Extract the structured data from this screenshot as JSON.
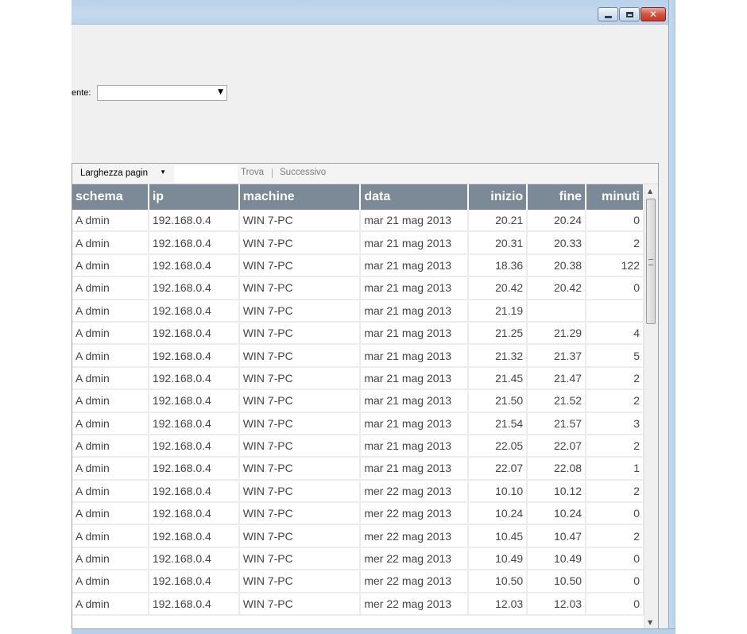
{
  "window": {
    "controls": {
      "minimize_icon": "minimize-icon",
      "maximize_icon": "maximize-icon",
      "close_glyph": "✕"
    }
  },
  "filter": {
    "label": "ente:",
    "value": ""
  },
  "toolbar": {
    "zoom_value": "Larghezza pagin",
    "find_text": "",
    "find_label": "Trova",
    "next_label": "Successivo"
  },
  "table": {
    "columns": [
      {
        "key": "schema",
        "label": "schema",
        "align": "left"
      },
      {
        "key": "ip",
        "label": "ip",
        "align": "left"
      },
      {
        "key": "machine",
        "label": "machine",
        "align": "left"
      },
      {
        "key": "data",
        "label": "data",
        "align": "left"
      },
      {
        "key": "inizio",
        "label": "inizio",
        "align": "right"
      },
      {
        "key": "fine",
        "label": "fine",
        "align": "right"
      },
      {
        "key": "minuti",
        "label": "minuti",
        "align": "right"
      }
    ],
    "rows": [
      [
        "A dmin",
        "192.168.0.4",
        "WIN 7-PC",
        "mar 21 mag 2013",
        "20.21",
        "20.24",
        "0"
      ],
      [
        "A dmin",
        "192.168.0.4",
        "WIN 7-PC",
        "mar 21 mag 2013",
        "20.31",
        "20.33",
        "2"
      ],
      [
        "A dmin",
        "192.168.0.4",
        "WIN 7-PC",
        "mar 21 mag 2013",
        "18.36",
        "20.38",
        "122"
      ],
      [
        "A dmin",
        "192.168.0.4",
        "WIN 7-PC",
        "mar 21 mag 2013",
        "20.42",
        "20.42",
        "0"
      ],
      [
        "A dmin",
        "192.168.0.4",
        "WIN 7-PC",
        "mar 21 mag 2013",
        "21.19",
        "",
        ""
      ],
      [
        "A dmin",
        "192.168.0.4",
        "WIN 7-PC",
        "mar 21 mag 2013",
        "21.25",
        "21.29",
        "4"
      ],
      [
        "A dmin",
        "192.168.0.4",
        "WIN 7-PC",
        "mar 21 mag 2013",
        "21.32",
        "21.37",
        "5"
      ],
      [
        "A dmin",
        "192.168.0.4",
        "WIN 7-PC",
        "mar 21 mag 2013",
        "21.45",
        "21.47",
        "2"
      ],
      [
        "A dmin",
        "192.168.0.4",
        "WIN 7-PC",
        "mar 21 mag 2013",
        "21.50",
        "21.52",
        "2"
      ],
      [
        "A dmin",
        "192.168.0.4",
        "WIN 7-PC",
        "mar 21 mag 2013",
        "21.54",
        "21.57",
        "3"
      ],
      [
        "A dmin",
        "192.168.0.4",
        "WIN 7-PC",
        "mar 21 mag 2013",
        "22.05",
        "22.07",
        "2"
      ],
      [
        "A dmin",
        "192.168.0.4",
        "WIN 7-PC",
        "mar 21 mag 2013",
        "22.07",
        "22.08",
        "1"
      ],
      [
        "A dmin",
        "192.168.0.4",
        "WIN 7-PC",
        "mer 22 mag 2013",
        "10.10",
        "10.12",
        "2"
      ],
      [
        "A dmin",
        "192.168.0.4",
        "WIN 7-PC",
        "mer 22 mag 2013",
        "10.24",
        "10.24",
        "0"
      ],
      [
        "A dmin",
        "192.168.0.4",
        "WIN 7-PC",
        "mer 22 mag 2013",
        "10.45",
        "10.47",
        "2"
      ],
      [
        "A dmin",
        "192.168.0.4",
        "WIN 7-PC",
        "mer 22 mag 2013",
        "10.49",
        "10.49",
        "0"
      ],
      [
        "A dmin",
        "192.168.0.4",
        "WIN 7-PC",
        "mer 22 mag 2013",
        "10.50",
        "10.50",
        "0"
      ],
      [
        "A dmin",
        "192.168.0.4",
        "WIN 7-PC",
        "mer 22 mag 2013",
        "12.03",
        "12.03",
        "0"
      ]
    ]
  },
  "scrollbar": {
    "up_glyph": "▲",
    "down_glyph": "▼"
  },
  "colors": {
    "header_bg": "#7c8996",
    "header_text": "#ffffff",
    "cell_text": "#444444",
    "grid_line": "#ececec"
  }
}
